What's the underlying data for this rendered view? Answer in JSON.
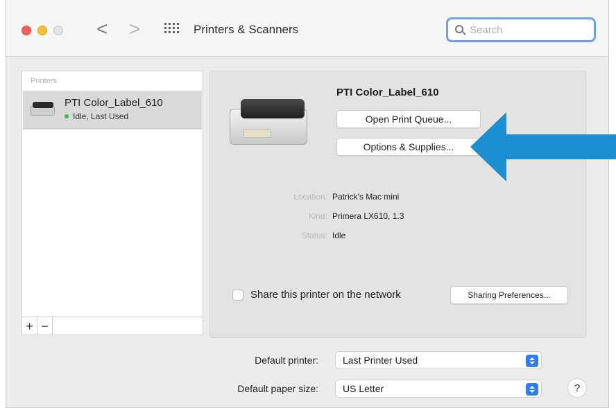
{
  "window": {
    "title": "Printers & Scanners",
    "search_placeholder": "Search",
    "back_glyph": "<",
    "forward_glyph": ">"
  },
  "sidebar": {
    "header": "Printers",
    "items": [
      {
        "name": "PTI Color_Label_610",
        "status": "Idle, Last Used",
        "status_color": "#2ec24a"
      }
    ],
    "add_label": "+",
    "remove_label": "−"
  },
  "details": {
    "printer_name": "PTI Color_Label_610",
    "open_queue_label": "Open Print Queue...",
    "options_label": "Options & Supplies...",
    "info": {
      "location_label": "Location:",
      "location_value": "Patrick's Mac mini",
      "kind_label": "Kind:",
      "kind_value": "Primera LX610, 1.3",
      "status_label": "Status:",
      "status_value": "Idle"
    },
    "share_label": "Share this printer on the network",
    "share_checked": false,
    "sharing_prefs_label": "Sharing Preferences..."
  },
  "defaults": {
    "printer_label": "Default printer:",
    "printer_value": "Last Printer Used",
    "paper_label": "Default paper size:",
    "paper_value": "US Letter"
  },
  "help_label": "?",
  "colors": {
    "accent": "#2d7df6",
    "callout_arrow": "#1b8fd1"
  }
}
